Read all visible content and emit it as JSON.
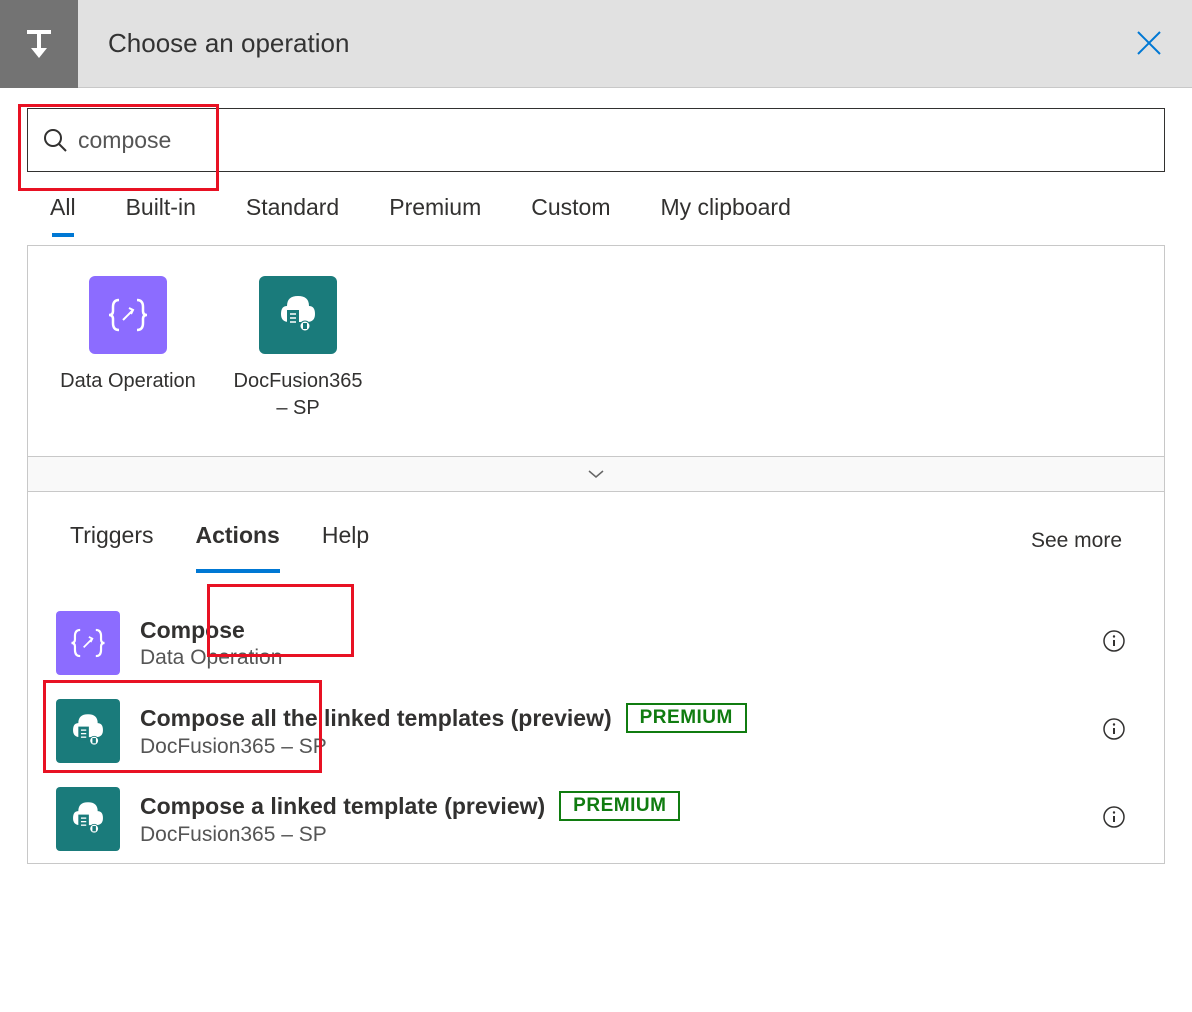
{
  "header": {
    "title": "Choose an operation"
  },
  "search": {
    "value": "compose"
  },
  "tabs": [
    {
      "label": "All",
      "active": true
    },
    {
      "label": "Built-in",
      "active": false
    },
    {
      "label": "Standard",
      "active": false
    },
    {
      "label": "Premium",
      "active": false
    },
    {
      "label": "Custom",
      "active": false
    },
    {
      "label": "My clipboard",
      "active": false
    }
  ],
  "connectors": [
    {
      "label": "Data Operation",
      "color": "purple",
      "icon": "braces"
    },
    {
      "label": "DocFusion365 – SP",
      "color": "teal",
      "icon": "docfusion"
    }
  ],
  "sub_tabs": {
    "items": [
      {
        "label": "Triggers",
        "active": false
      },
      {
        "label": "Actions",
        "active": true
      },
      {
        "label": "Help",
        "active": false
      }
    ],
    "see_more": "See more"
  },
  "actions": [
    {
      "title": "Compose",
      "sub": "Data Operation",
      "color": "purple",
      "icon": "braces",
      "premium": false
    },
    {
      "title": "Compose all the linked templates (preview)",
      "sub": "DocFusion365 – SP",
      "color": "teal",
      "icon": "docfusion",
      "premium": true
    },
    {
      "title": "Compose a linked template (preview)",
      "sub": "DocFusion365 – SP",
      "color": "teal",
      "icon": "docfusion",
      "premium": true
    }
  ],
  "badges": {
    "premium": "PREMIUM"
  }
}
